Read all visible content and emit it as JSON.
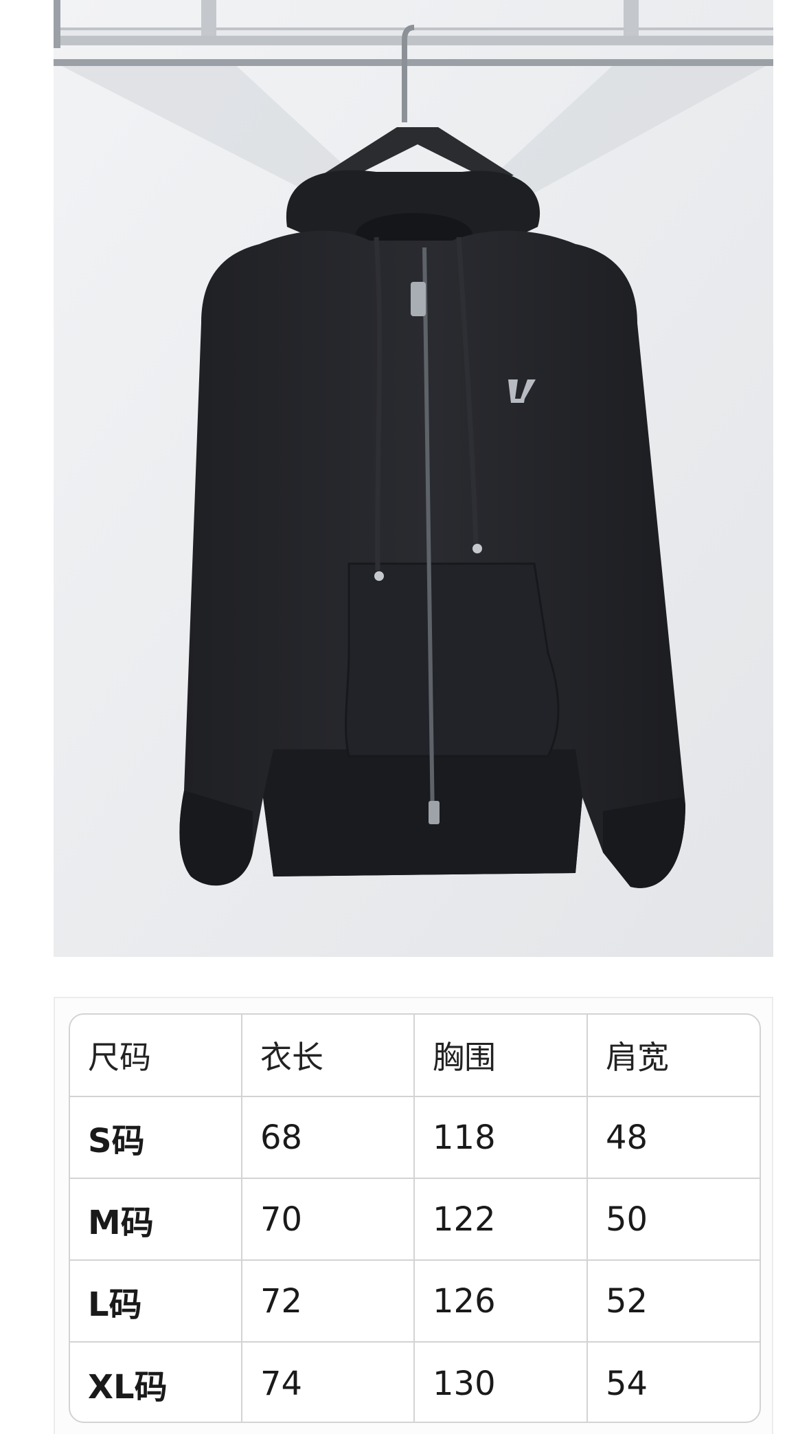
{
  "product_photo": {
    "subject": "black zip-up hoodie on hanger",
    "badge_icon": "brand-monogram-badge-icon"
  },
  "size_table": {
    "headers": [
      "尺码",
      "衣长",
      "胸围",
      "肩宽"
    ],
    "rows": [
      [
        "S码",
        "68",
        "118",
        "48"
      ],
      [
        "M码",
        "70",
        "122",
        "50"
      ],
      [
        "L码",
        "72",
        "126",
        "52"
      ],
      [
        "XL码",
        "74",
        "130",
        "54"
      ]
    ]
  },
  "colors": {
    "border": "#d3d3d3",
    "text": "#1a1a1a",
    "garment": "#25262b"
  }
}
